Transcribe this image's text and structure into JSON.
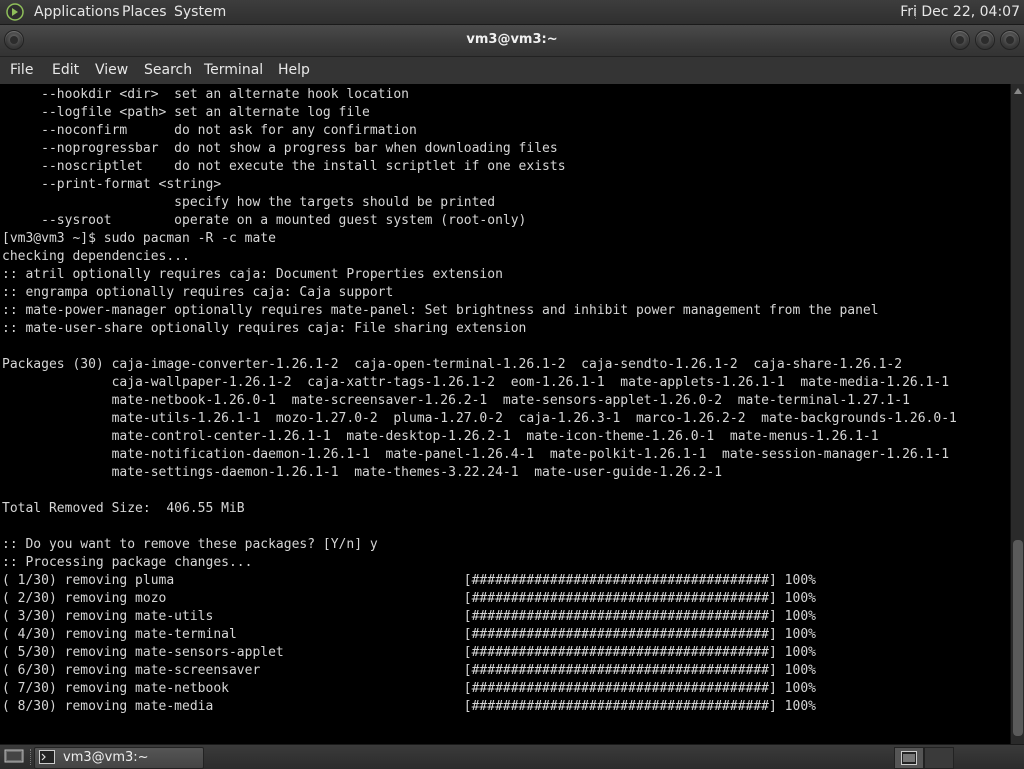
{
  "top_panel": {
    "menus": [
      "Applications",
      "Places",
      "System"
    ],
    "clock": "Fri Dec 22, 04:07"
  },
  "window": {
    "title": "vm3@vm3:~",
    "menu": [
      "File",
      "Edit",
      "View",
      "Search",
      "Terminal",
      "Help"
    ]
  },
  "terminal": {
    "lines": [
      "     --hookdir <dir>  set an alternate hook location",
      "     --logfile <path> set an alternate log file",
      "     --noconfirm      do not ask for any confirmation",
      "     --noprogressbar  do not show a progress bar when downloading files",
      "     --noscriptlet    do not execute the install scriptlet if one exists",
      "     --print-format <string>",
      "                      specify how the targets should be printed",
      "     --sysroot        operate on a mounted guest system (root-only)",
      "[vm3@vm3 ~]$ sudo pacman -R -c mate",
      "checking dependencies...",
      ":: atril optionally requires caja: Document Properties extension",
      ":: engrampa optionally requires caja: Caja support",
      ":: mate-power-manager optionally requires mate-panel: Set brightness and inhibit power management from the panel",
      ":: mate-user-share optionally requires caja: File sharing extension",
      "",
      "Packages (30) caja-image-converter-1.26.1-2  caja-open-terminal-1.26.1-2  caja-sendto-1.26.1-2  caja-share-1.26.1-2",
      "              caja-wallpaper-1.26.1-2  caja-xattr-tags-1.26.1-2  eom-1.26.1-1  mate-applets-1.26.1-1  mate-media-1.26.1-1",
      "              mate-netbook-1.26.0-1  mate-screensaver-1.26.2-1  mate-sensors-applet-1.26.0-2  mate-terminal-1.27.1-1",
      "              mate-utils-1.26.1-1  mozo-1.27.0-2  pluma-1.27.0-2  caja-1.26.3-1  marco-1.26.2-2  mate-backgrounds-1.26.0-1",
      "              mate-control-center-1.26.1-1  mate-desktop-1.26.2-1  mate-icon-theme-1.26.0-1  mate-menus-1.26.1-1",
      "              mate-notification-daemon-1.26.1-1  mate-panel-1.26.4-1  mate-polkit-1.26.1-1  mate-session-manager-1.26.1-1",
      "              mate-settings-daemon-1.26.1-1  mate-themes-3.22.24-1  mate-user-guide-1.26.2-1",
      "",
      "Total Removed Size:  406.55 MiB",
      "",
      ":: Do you want to remove these packages? [Y/n] y",
      ":: Processing package changes...",
      "( 1/30) removing pluma                                     [######################################] 100%",
      "( 2/30) removing mozo                                      [######################################] 100%",
      "( 3/30) removing mate-utils                                [######################################] 100%",
      "( 4/30) removing mate-terminal                             [######################################] 100%",
      "( 5/30) removing mate-sensors-applet                       [######################################] 100%",
      "( 6/30) removing mate-screensaver                          [######################################] 100%",
      "( 7/30) removing mate-netbook                              [######################################] 100%",
      "( 8/30) removing mate-media                                [######################################] 100%"
    ]
  },
  "taskbar": {
    "task_label": "vm3@vm3:~"
  },
  "icons": {
    "logo": "mate-logo-icon",
    "show_desktop": "show-desktop-icon",
    "terminal": "terminal-icon"
  },
  "colors": {
    "terminal_bg": "#000000",
    "terminal_fg": "#d6d6d6",
    "panel_bg": "#343434"
  }
}
